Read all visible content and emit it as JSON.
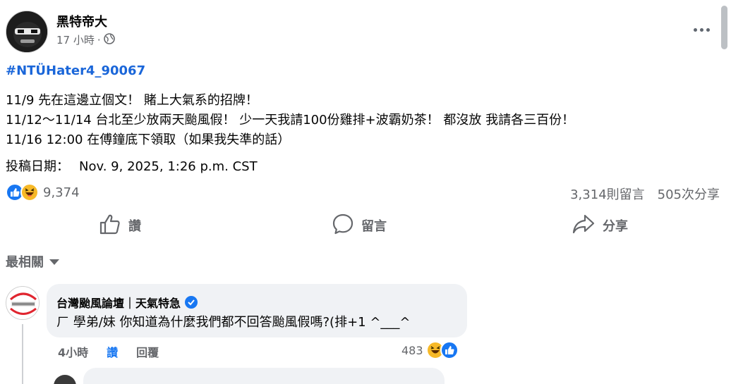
{
  "post": {
    "author": "黑特帝大",
    "time": "17 小時",
    "separator": "·",
    "privacy_icon": "globe-icon",
    "hashtag": "#NTÜHater4_90067",
    "lines": [
      "11/9 先在這邊立個文！ 賭上大氣系的招牌！",
      "11/12～11/14 台北至少放兩天颱風假！ 少一天我請100份雞排+波霸奶茶！ 都沒放 我請各三百份！",
      "11/16 12:00 在傅鐘底下領取（如果我失準的話）"
    ],
    "date_label": "投稿日期：",
    "date_value": "Nov. 9, 2025, 1:26 p.m. CST"
  },
  "stats": {
    "reaction_count": "9,374",
    "comments": "3,314則留言",
    "shares": "505次分享"
  },
  "actions": {
    "like": "讚",
    "comment": "留言",
    "share": "分享"
  },
  "filter": {
    "label": "最相關"
  },
  "comment": {
    "author": "台灣颱風論壇｜天氣特急",
    "text": "ㄏ 學弟/妹 你知道為什麼我們都不回答颱風假嗎?(排+1 ^___^",
    "time": "4小時",
    "like": "讚",
    "reply": "回覆",
    "reaction_count": "483"
  },
  "colors": {
    "accent": "#1877f2",
    "hashtag": "#1a66d9",
    "muted": "#65676b",
    "bubble": "#f0f2f5"
  }
}
